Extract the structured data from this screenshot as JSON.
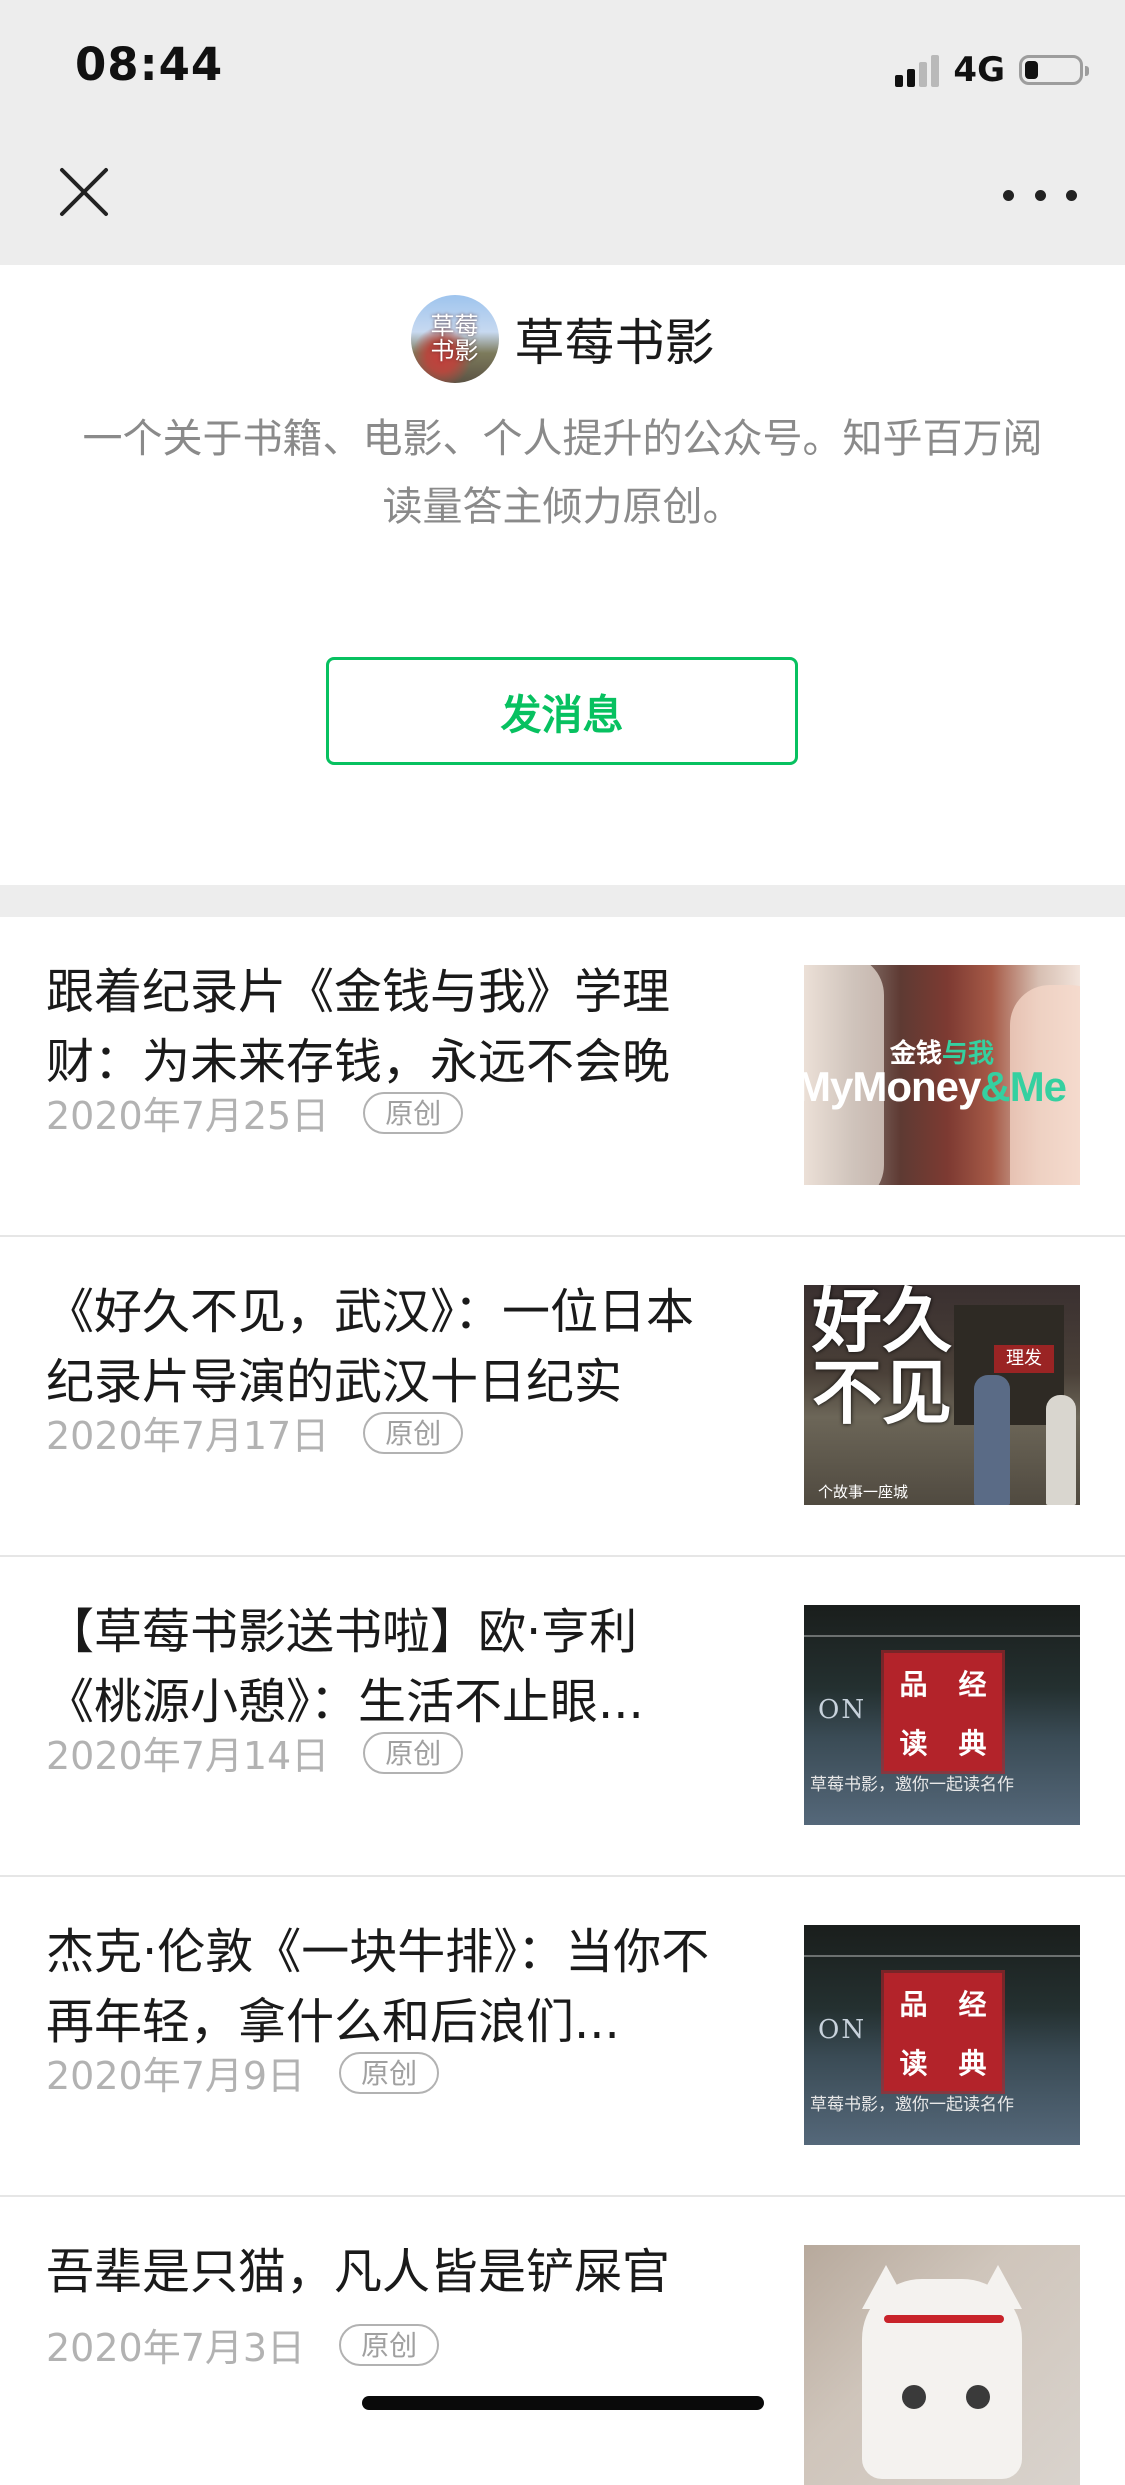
{
  "status_bar": {
    "time": "08:44",
    "network": "4G",
    "signal_bars_active": 2,
    "signal_bars_total": 4,
    "battery_level": 0.25
  },
  "nav": {
    "close_icon": "close-icon",
    "more_icon": "more-dots-icon"
  },
  "account": {
    "avatar_text": "草莓书影",
    "name": "草莓书影",
    "description": "一个关于书籍、电影、个人提升的公众号。知乎百万阅读量答主倾力原创。",
    "message_button": "发消息"
  },
  "articles": [
    {
      "title": "跟着纪录片《金钱与我》学理财：为未来存钱，永远不会晚",
      "date": "2020年7月25日",
      "badge": "原创",
      "thumb": {
        "cn_a": "金钱",
        "cn_b": "与我",
        "en_a": "MyMoney",
        "en_b": "&Me"
      }
    },
    {
      "title": "《好久不见，武汉》：一位日本纪录片导演的武汉十日纪实",
      "date": "2020年7月17日",
      "badge": "原创",
      "thumb": {
        "calligraphy": "好久不见",
        "sign": "理发",
        "sub": "个故事一座城"
      }
    },
    {
      "title": "【草莓书影送书啦】欧·亨利《桃源小憩》：生活不止眼...",
      "date": "2020年7月14日",
      "badge": "原创",
      "thumb": {
        "stamp": [
          "品",
          "经",
          "读",
          "典"
        ],
        "book_text": "ON",
        "caption": "草莓书影，邀你一起读名作"
      }
    },
    {
      "title": "杰克·伦敦《一块牛排》：当你不再年轻，拿什么和后浪们...",
      "date": "2020年7月9日",
      "badge": "原创",
      "thumb": {
        "stamp": [
          "品",
          "经",
          "读",
          "典"
        ],
        "book_text": "ON",
        "caption": "草莓书影，邀你一起读名作"
      }
    },
    {
      "title": "吾辈是只猫，凡人皆是铲屎官",
      "date": "2020年7月3日",
      "badge": "原创",
      "thumb": {}
    }
  ],
  "colors": {
    "accent_green": "#07c160",
    "header_bg": "#ededed",
    "meta_gray": "#b2b2b2"
  }
}
